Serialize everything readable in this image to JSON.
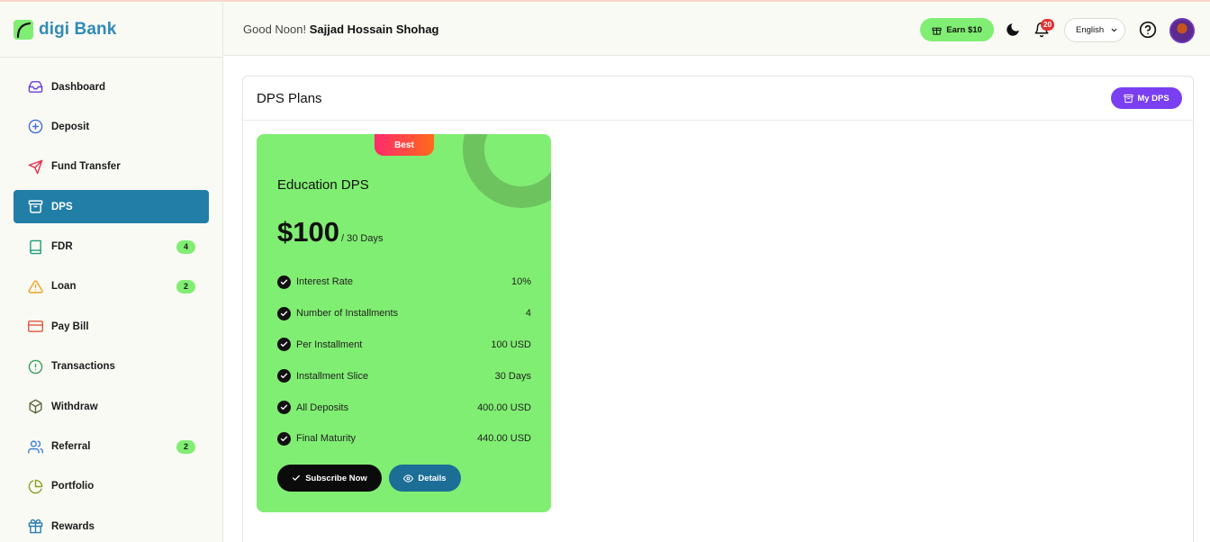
{
  "brand": {
    "name_part1": "digi",
    "name_part2": " Bank"
  },
  "header": {
    "greeting": "Good Noon!",
    "user_name": "Sajjad Hossain Shohag",
    "earn_label": "Earn $10",
    "notification_count": "20",
    "language": "English"
  },
  "sidebar": {
    "items": [
      {
        "label": "Dashboard",
        "icon": "inbox-icon"
      },
      {
        "label": "Deposit",
        "icon": "plus-circle-icon"
      },
      {
        "label": "Fund Transfer",
        "icon": "send-icon"
      },
      {
        "label": "DPS",
        "icon": "archive-icon",
        "active": true
      },
      {
        "label": "FDR",
        "icon": "book-icon",
        "badge": "4"
      },
      {
        "label": "Loan",
        "icon": "alert-triangle-icon",
        "badge": "2"
      },
      {
        "label": "Pay Bill",
        "icon": "credit-card-icon"
      },
      {
        "label": "Transactions",
        "icon": "alert-circle-icon"
      },
      {
        "label": "Withdraw",
        "icon": "box-icon"
      },
      {
        "label": "Referral",
        "icon": "users-icon",
        "badge": "2"
      },
      {
        "label": "Portfolio",
        "icon": "pie-chart-icon"
      },
      {
        "label": "Rewards",
        "icon": "gift-icon"
      }
    ]
  },
  "main": {
    "title": "DPS Plans",
    "my_dps_label": "My DPS",
    "plan": {
      "tag": "Best",
      "name": "Education DPS",
      "price": "$100",
      "period": "/ 30 Days",
      "features": [
        {
          "label": "Interest Rate",
          "value": "10%"
        },
        {
          "label": "Number of Installments",
          "value": "4"
        },
        {
          "label": "Per Installment",
          "value": "100 USD"
        },
        {
          "label": "Installment Slice",
          "value": "30 Days"
        },
        {
          "label": "All Deposits",
          "value": "400.00 USD"
        },
        {
          "label": "Final Maturity",
          "value": "440.00 USD"
        }
      ],
      "subscribe_label": "Subscribe Now",
      "details_label": "Details"
    }
  },
  "colors": {
    "accent_green": "#80ee72",
    "active_nav": "#217ea6",
    "primary_purple": "#7a3ff0",
    "details_blue": "#1d6e96"
  }
}
